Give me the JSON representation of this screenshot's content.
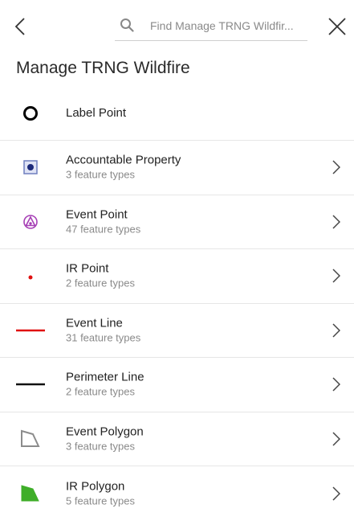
{
  "header": {
    "search_placeholder": "Find Manage TRNG Wildfir...",
    "title": "Manage TRNG Wildfire"
  },
  "icons": {
    "back": "chevron-left-icon",
    "search": "search-icon",
    "close": "close-icon"
  },
  "colors": {
    "event_line": "#e01010",
    "ir_point": "#e01010",
    "event_point": "#a63fb5",
    "ir_polygon": "#3fae29",
    "accountable_property": "#1c2a7a",
    "event_polygon": "#8c8c8c"
  },
  "items": [
    {
      "label": "Label Point",
      "subtitle": "",
      "icon": "circle-outline-icon"
    },
    {
      "label": "Accountable Property",
      "subtitle": "3 feature types",
      "icon": "square-dot-icon"
    },
    {
      "label": "Event Point",
      "subtitle": "47 feature types",
      "icon": "event-point-icon"
    },
    {
      "label": "IR Point",
      "subtitle": "2 feature types",
      "icon": "red-dot-icon"
    },
    {
      "label": "Event Line",
      "subtitle": "31 feature types",
      "icon": "red-line-icon"
    },
    {
      "label": "Perimeter Line",
      "subtitle": "2 feature types",
      "icon": "black-line-icon"
    },
    {
      "label": "Event Polygon",
      "subtitle": "3 feature types",
      "icon": "gray-polygon-icon"
    },
    {
      "label": "IR Polygon",
      "subtitle": "5 feature types",
      "icon": "green-polygon-icon"
    }
  ]
}
